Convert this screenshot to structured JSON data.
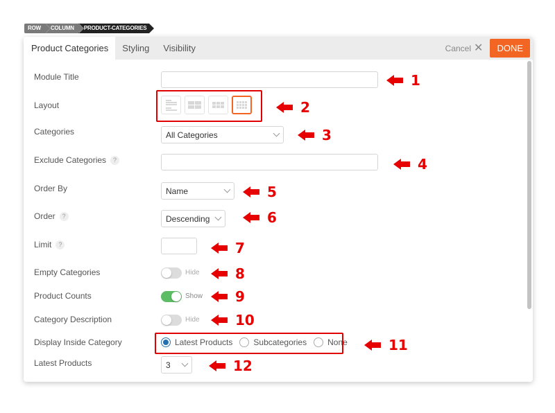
{
  "breadcrumb": [
    "ROW",
    "COLUMN",
    "PRODUCT-CATEGORIES"
  ],
  "tabs": [
    {
      "label": "Product Categories",
      "active": true
    },
    {
      "label": "Styling",
      "active": false
    },
    {
      "label": "Visibility",
      "active": false
    }
  ],
  "actions": {
    "cancel_label": "Cancel",
    "cancel_icon": "close-icon",
    "done_label": "DONE"
  },
  "colors": {
    "accent": "#f26522",
    "toggle_on": "#5cbd64",
    "radio_checked": "#2271b1",
    "annotation": "#e60000"
  },
  "fields": {
    "module_title": {
      "label": "Module Title",
      "value": ""
    },
    "layout": {
      "label": "Layout",
      "options": [
        "list-post",
        "grid-2",
        "grid-3",
        "grid-4"
      ],
      "selected": "grid-4"
    },
    "categories": {
      "label": "Categories",
      "value": "All Categories"
    },
    "exclude_categories": {
      "label": "Exclude Categories",
      "help": "?",
      "value": ""
    },
    "order_by": {
      "label": "Order By",
      "value": "Name"
    },
    "order": {
      "label": "Order",
      "help": "?",
      "value": "Descending"
    },
    "limit": {
      "label": "Limit",
      "help": "?",
      "value": ""
    },
    "empty_categories": {
      "label": "Empty Categories",
      "state": "Hide",
      "on": false
    },
    "product_counts": {
      "label": "Product Counts",
      "state": "Show",
      "on": true
    },
    "category_description": {
      "label": "Category Description",
      "state": "Hide",
      "on": false
    },
    "display_inside_category": {
      "label": "Display Inside Category",
      "options": [
        "Latest Products",
        "Subcategories",
        "None"
      ],
      "selected": "Latest Products"
    },
    "latest_products": {
      "label": "Latest Products",
      "value": "3"
    }
  },
  "annotations": [
    "1",
    "2",
    "3",
    "4",
    "5",
    "6",
    "7",
    "8",
    "9",
    "10",
    "11",
    "12"
  ]
}
